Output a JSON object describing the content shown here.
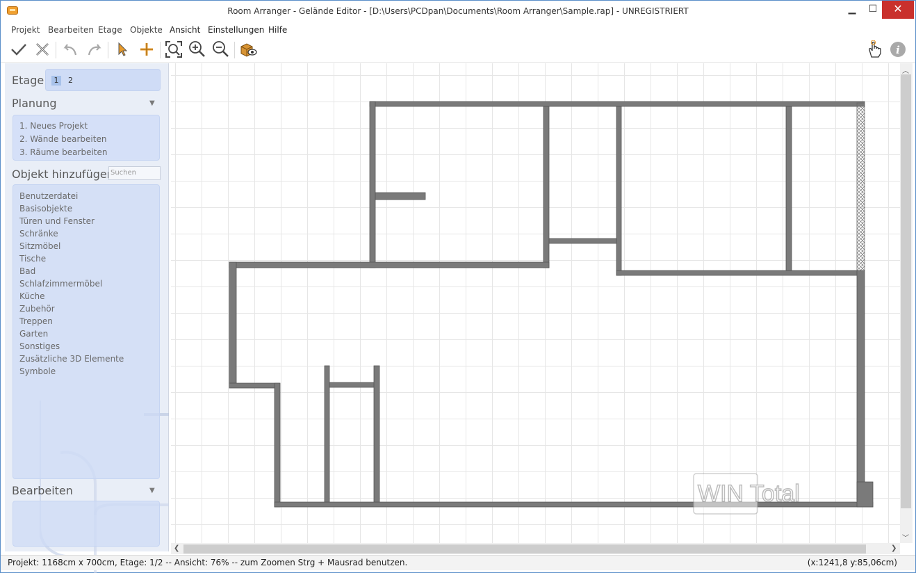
{
  "window": {
    "title": "Room Arranger - Gelände Editor - [D:\\Users\\PCDpan\\Documents\\Room Arranger\\Sample.rap] - UNREGISTRIERT",
    "min": "▁",
    "max": "☐",
    "close": "✕"
  },
  "menu": [
    "Projekt",
    "Bearbeiten",
    "Etage",
    "Objekte",
    "Ansicht",
    "Einstellungen",
    "Hilfe"
  ],
  "toolbar": {
    "icons": [
      "check-icon",
      "cancel-icon",
      "undo-icon",
      "redo-icon",
      "pointer-icon",
      "add-point-icon",
      "zoom-fit-icon",
      "zoom-in-icon",
      "zoom-out-icon",
      "3d-view-icon",
      "hand-icon",
      "info-icon"
    ]
  },
  "sidebar": {
    "etage_label": "Etage",
    "etage_1": "1",
    "etage_2": "2",
    "planung_label": "Planung",
    "planung_items": [
      "1. Neues Projekt",
      "2. Wände bearbeiten",
      "3. Räume bearbeiten"
    ],
    "objekt_label": "Objekt hinzufügen",
    "search_placeholder": "Suchen",
    "objects": [
      "Benutzerdatei",
      "Basisobjekte",
      "Türen und Fenster",
      "Schränke",
      "Sitzmöbel",
      "Tische",
      "Bad",
      "Schlafzimmermöbel",
      "Küche",
      "Zubehör",
      "Treppen",
      "Garten",
      "Sonstiges",
      "Zusätzliche 3D Elemente",
      "Symbole"
    ],
    "bearbeiten_label": "Bearbeiten"
  },
  "canvas": {
    "watermark": "WIN Total",
    "wall_color": "#7a7a7a"
  },
  "status": {
    "left": "Projekt: 1168cm x 700cm, Etage: 1/2 -- Ansicht: 76% -- zum Zoomen Strg + Mausrad benutzen.",
    "right": "(x:1241,8 y:85,06cm)"
  }
}
